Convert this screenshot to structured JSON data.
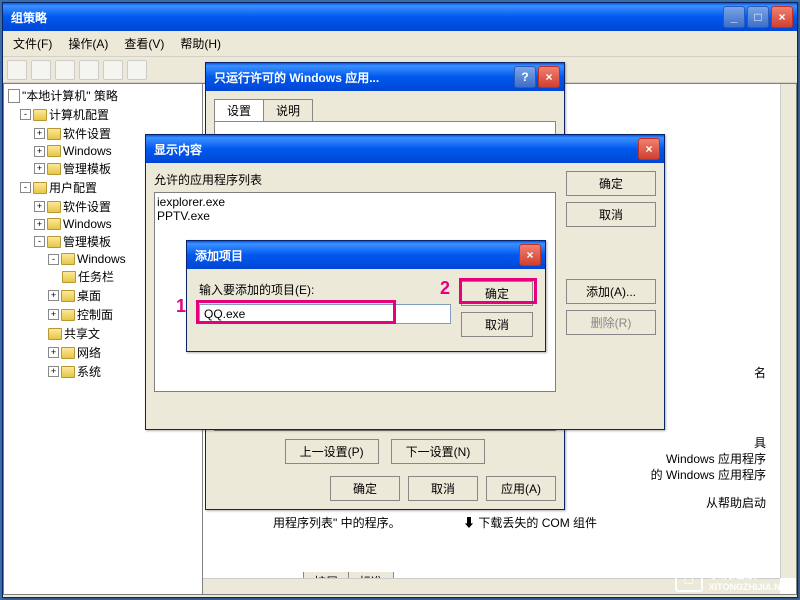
{
  "main_window": {
    "title": "组策略",
    "menu": {
      "file": "文件(F)",
      "action": "操作(A)",
      "view": "查看(V)",
      "help": "帮助(H)"
    }
  },
  "tree": {
    "root": "\"本地计算机\" 策略",
    "computer_config": "计算机配置",
    "software_settings": "软件设置",
    "windows": "Windows",
    "admin_templates": "管理模板",
    "user_config": "用户配置",
    "taskbar": "任务栏",
    "desktop": "桌面",
    "control_panel": "控制面",
    "share": "共享文",
    "network": "网络",
    "system": "系统"
  },
  "content": {
    "fragment1": "名",
    "fragment2": "具",
    "fragment3": "Windows 应用程序",
    "fragment4": "的 Windows 应用程序",
    "fragment5": "从帮助启动",
    "fragment6": "下载丢失的 COM 组件",
    "fragment7": "用程序列表\" 中的程序。",
    "tab_ext": "扩展",
    "tab_std": "标准"
  },
  "policy_dialog": {
    "title": "只运行许可的 Windows 应用...",
    "tab_setting": "设置",
    "tab_explain": "说明",
    "prev": "上一设置(P)",
    "next": "下一设置(N)",
    "ok": "确定",
    "cancel": "取消",
    "apply": "应用(A)"
  },
  "show_dialog": {
    "title": "显示内容",
    "list_label": "允许的应用程序列表",
    "items": [
      "iexplorer.exe",
      "PPTV.exe"
    ],
    "ok": "确定",
    "cancel": "取消",
    "add": "添加(A)...",
    "remove": "删除(R)"
  },
  "add_dialog": {
    "title": "添加项目",
    "label": "输入要添加的项目(E):",
    "value": "QQ.exe",
    "ok": "确定",
    "cancel": "取消"
  },
  "annotations": {
    "one": "1",
    "two": "2"
  },
  "watermark": {
    "text": "系统之家",
    "sub": "XITONGZHIJIA.NET"
  }
}
